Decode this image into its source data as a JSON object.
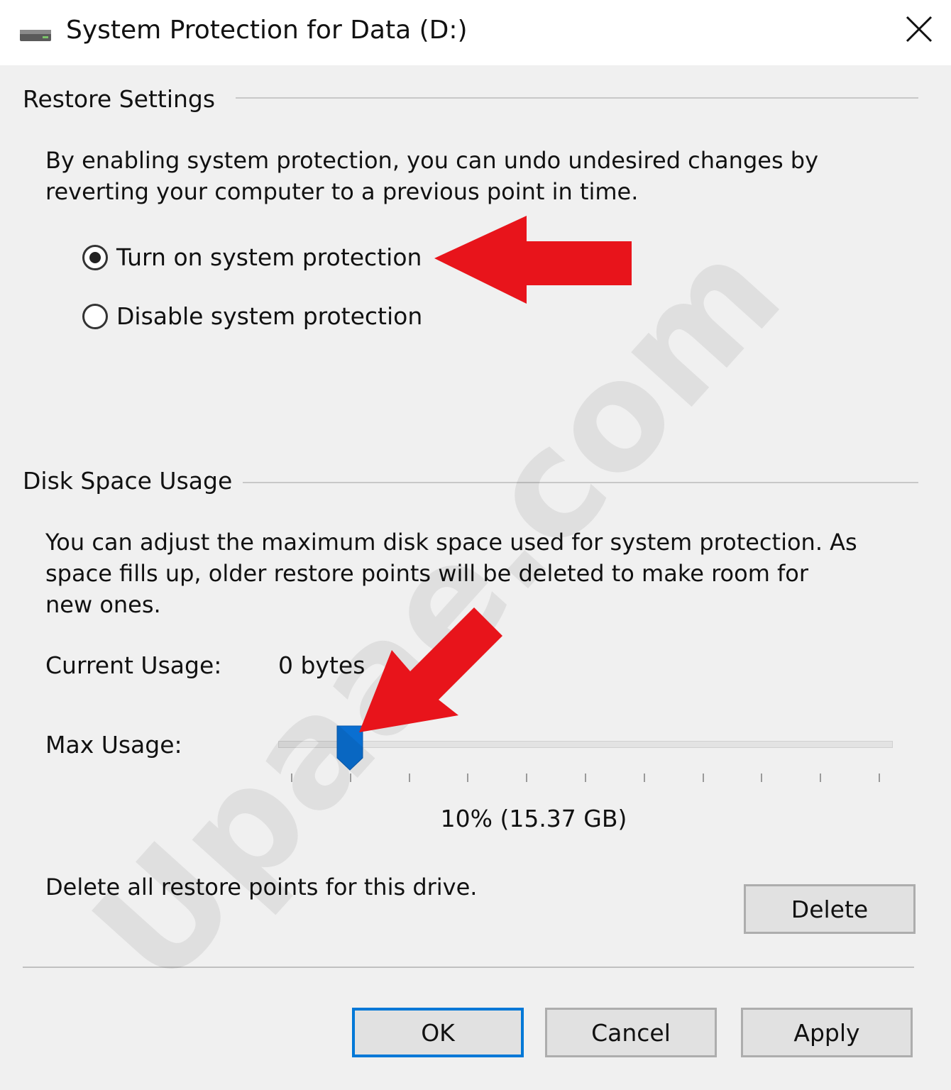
{
  "window": {
    "title": "System Protection for Data (D:)",
    "close_icon": "close-icon",
    "drive_icon": "drive-icon"
  },
  "restore_settings": {
    "label": "Restore Settings",
    "description": "By enabling system protection, you can undo undesired changes by reverting your computer to a previous point in time.",
    "options": [
      {
        "label": "Turn on system protection",
        "checked": true
      },
      {
        "label": "Disable system protection",
        "checked": false
      }
    ]
  },
  "disk_space": {
    "label": "Disk Space Usage",
    "description": "You can adjust the maximum disk space used for system protection. As space fills up, older restore points will be deleted to make room for new ones.",
    "current_usage_label": "Current Usage:",
    "current_usage_value": "0 bytes",
    "max_usage_label": "Max Usage:",
    "max_usage_percent": 10,
    "max_usage_text": "10% (15.37 GB)",
    "delete_label": "Delete all restore points for this drive.",
    "delete_button": "Delete"
  },
  "footer": {
    "ok": "OK",
    "cancel": "Cancel",
    "apply": "Apply"
  },
  "watermark": {
    "text": "Upaae.com"
  },
  "colors": {
    "accent": "#0078d7",
    "annotation_arrow": "#e8141b",
    "slider_thumb": "#0a6fd1"
  }
}
